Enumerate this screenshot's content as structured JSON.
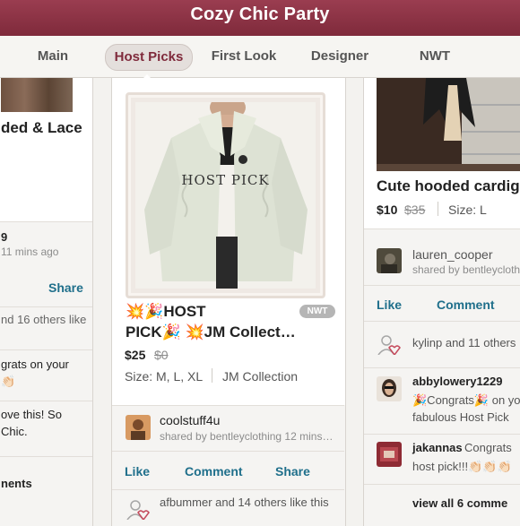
{
  "app": {
    "title": "Cozy Chic Party"
  },
  "tabs": [
    {
      "label": "Main"
    },
    {
      "label": "Host Picks"
    },
    {
      "label": "First Look"
    },
    {
      "label": "Designer"
    },
    {
      "label": "NWT"
    }
  ],
  "left_card": {
    "title_fragment": "ded & Lace",
    "meta_num": "9",
    "meta_time": "11 mins ago",
    "share": "Share",
    "likes": "nd 16 others like",
    "comment1_l1": "grats on your",
    "comment1_l2": "👏🏻",
    "comment2_l1": "ove this!  So",
    "comment2_l2": "Chic.",
    "view_comments": "nents"
  },
  "center_card": {
    "watermark": "HOST PICK",
    "badge": "NWT",
    "title_l1": "💥🎉HOST",
    "title_l2": "PICK🎉 💥JM Collect…",
    "price": "$25",
    "orig_price": "$0",
    "size": "Size: M, L, XL",
    "brand": "JM Collection",
    "user": "coolstuff4u",
    "shared_by": "shared by bentleyclothing 12 mins…",
    "like": "Like",
    "comment": "Comment",
    "share": "Share",
    "likes_text": "afbummer and 14 others like this"
  },
  "right_card": {
    "title": "Cute hooded cardig",
    "price": "$10",
    "orig_price": "$35",
    "size": "Size: L",
    "user": "lauren_cooper",
    "shared_by": "shared by bentleycloth",
    "like": "Like",
    "comment": "Comment",
    "likes_text": "kylinp and 11 others",
    "c1_user": "abbylowery1229",
    "c1_l1": "🎉Congrats🎉 on yo",
    "c1_l2": "fabulous Host Pick",
    "c2_user": "jakannas",
    "c2_l1": " Congrats",
    "c2_l2": "host pick!!!👏🏻👏🏻👏🏻",
    "view_comments": "view all 6 comme"
  },
  "colors": {
    "brand": "#7f2a3b",
    "link": "#1f6f8b"
  }
}
